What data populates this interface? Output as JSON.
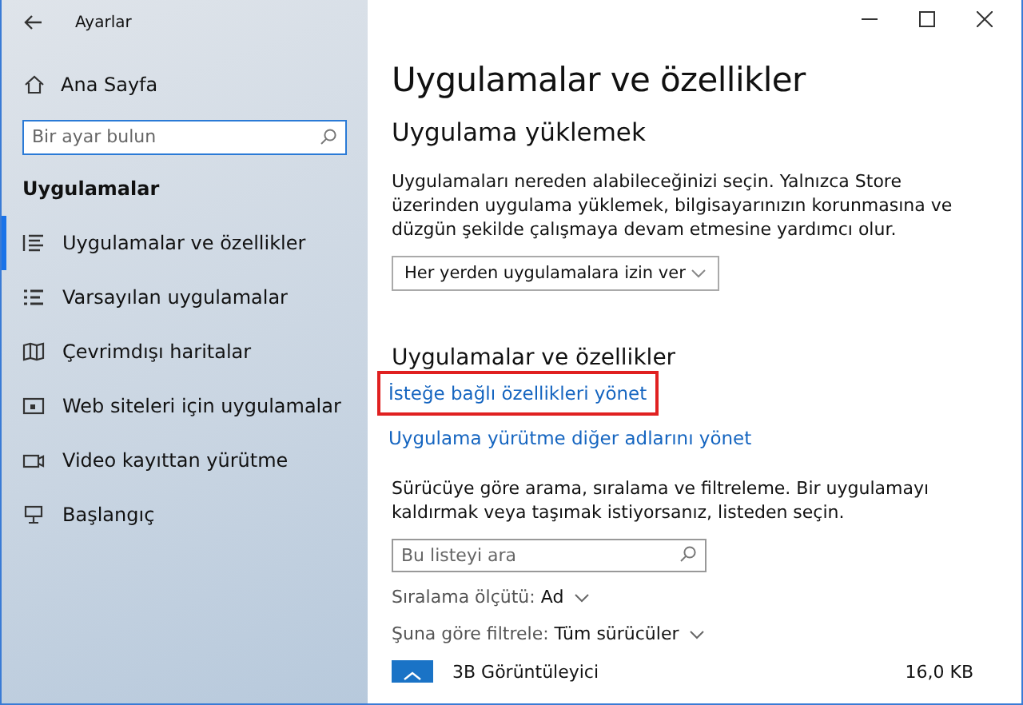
{
  "window": {
    "title": "Ayarlar"
  },
  "sidebar": {
    "home": "Ana Sayfa",
    "search": {
      "placeholder": "Bir ayar bulun"
    },
    "section": "Uygulamalar",
    "items": [
      {
        "label": "Uygulamalar ve özellikler",
        "selected": true
      },
      {
        "label": "Varsayılan uygulamalar",
        "selected": false
      },
      {
        "label": "Çevrimdışı haritalar",
        "selected": false
      },
      {
        "label": "Web siteleri için uygulamalar",
        "selected": false
      },
      {
        "label": "Video kayıttan yürütme",
        "selected": false
      },
      {
        "label": "Başlangıç",
        "selected": false
      }
    ]
  },
  "main": {
    "title": "Uygulamalar ve özellikler",
    "install": {
      "heading": "Uygulama yüklemek",
      "text": "Uygulamaları nereden alabileceğinizi seçin. Yalnızca Store üzerinden uygulama yüklemek, bilgisayarınızın korunmasına ve düzgün şekilde çalışmaya devam etmesine yardımcı olur.",
      "dropdown": "Her yerden uygulamalara izin ver"
    },
    "apps": {
      "heading": "Uygulamalar ve özellikler",
      "links": [
        {
          "label": "İsteğe bağlı özellikleri yönet",
          "highlighted": true
        },
        {
          "label": "Uygulama yürütme diğer adlarını yönet",
          "highlighted": false
        }
      ],
      "text": "Sürücüye göre arama, sıralama ve filtreleme. Bir uygulamayı kaldırmak veya taşımak istiyorsanız, listeden seçin.",
      "search": {
        "placeholder": "Bu listeyi ara"
      },
      "sort": {
        "label": "Sıralama ölçütü:",
        "value": "Ad"
      },
      "filter": {
        "label": "Şuna göre filtrele:",
        "value": "Tüm sürücüler"
      },
      "list": [
        {
          "name": "3B Görüntüleyici",
          "size": "16,0 KB"
        }
      ]
    }
  }
}
